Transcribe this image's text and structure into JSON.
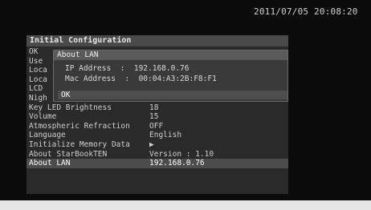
{
  "status": {
    "datetime": "2011/07/05 20:08:20"
  },
  "config": {
    "title": "Initial Configuration",
    "rows": [
      {
        "label": "OK",
        "value": ""
      },
      {
        "label": "Use",
        "value": ""
      },
      {
        "label": "Loca",
        "value": ""
      },
      {
        "label": "Loca",
        "value": ""
      },
      {
        "label": "LCD",
        "value": ""
      },
      {
        "label": "Nigh",
        "value": ""
      },
      {
        "label": "Key LED Brightness",
        "value": "18"
      },
      {
        "label": "Volume",
        "value": "15"
      },
      {
        "label": "Atmospheric Refraction",
        "value": "OFF"
      },
      {
        "label": "Language",
        "value": "English"
      },
      {
        "label": "Initialize Memory Data",
        "value": "▶"
      },
      {
        "label": "About StarBookTEN",
        "value": "Version : 1.10"
      },
      {
        "label": "About LAN",
        "value": "192.168.0.76"
      }
    ]
  },
  "dialog": {
    "title": "About LAN",
    "ip_label": "IP Address",
    "ip_value": "192.168.0.76",
    "mac_label": "Mac Address",
    "mac_value": "00:04:A3:2B:F8:F1",
    "ok_label": "OK"
  }
}
